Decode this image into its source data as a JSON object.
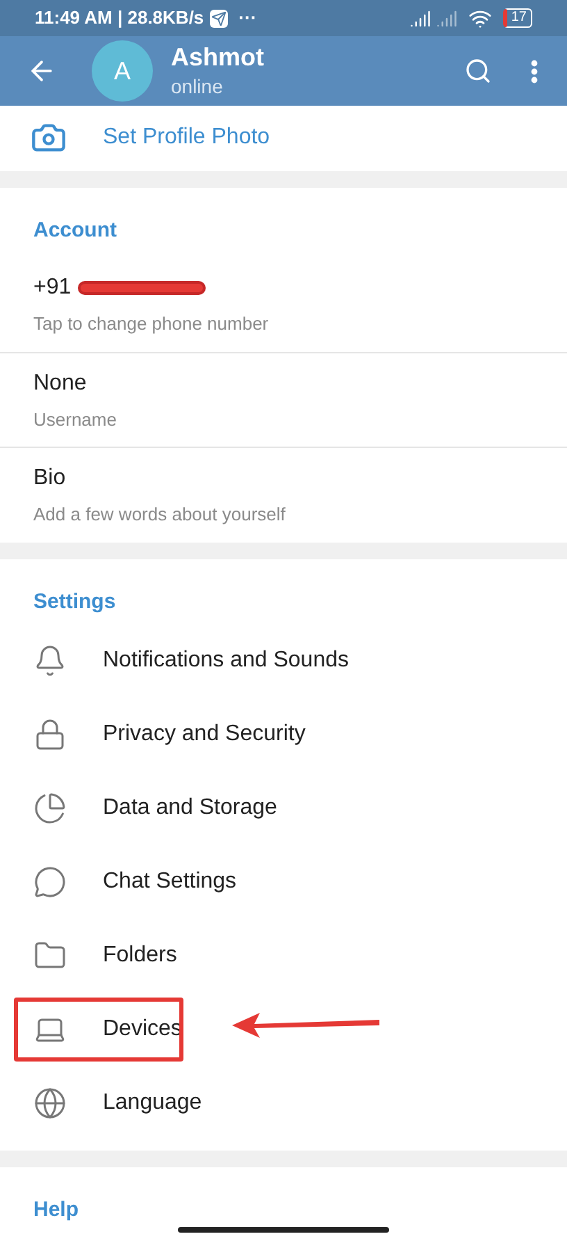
{
  "status_bar": {
    "time_speed": "11:49 AM | 28.8KB/s",
    "more": "···",
    "battery": "17"
  },
  "header": {
    "avatar_letter": "A",
    "name": "Ashmot",
    "status": "online"
  },
  "set_photo": {
    "label": "Set Profile Photo"
  },
  "account": {
    "title": "Account",
    "items": [
      {
        "value": "+91",
        "hint": "Tap to change phone number",
        "redacted": true
      },
      {
        "value": "None",
        "hint": "Username",
        "redacted": false
      },
      {
        "value": "Bio",
        "hint": "Add a few words about yourself",
        "redacted": false
      }
    ]
  },
  "settings": {
    "title": "Settings",
    "items": [
      {
        "label": "Notifications and Sounds",
        "highlighted": false
      },
      {
        "label": "Privacy and Security",
        "highlighted": false
      },
      {
        "label": "Data and Storage",
        "highlighted": false
      },
      {
        "label": "Chat Settings",
        "highlighted": false
      },
      {
        "label": "Folders",
        "highlighted": false
      },
      {
        "label": "Devices",
        "highlighted": true
      },
      {
        "label": "Language",
        "highlighted": false
      }
    ]
  },
  "help": {
    "title": "Help"
  }
}
